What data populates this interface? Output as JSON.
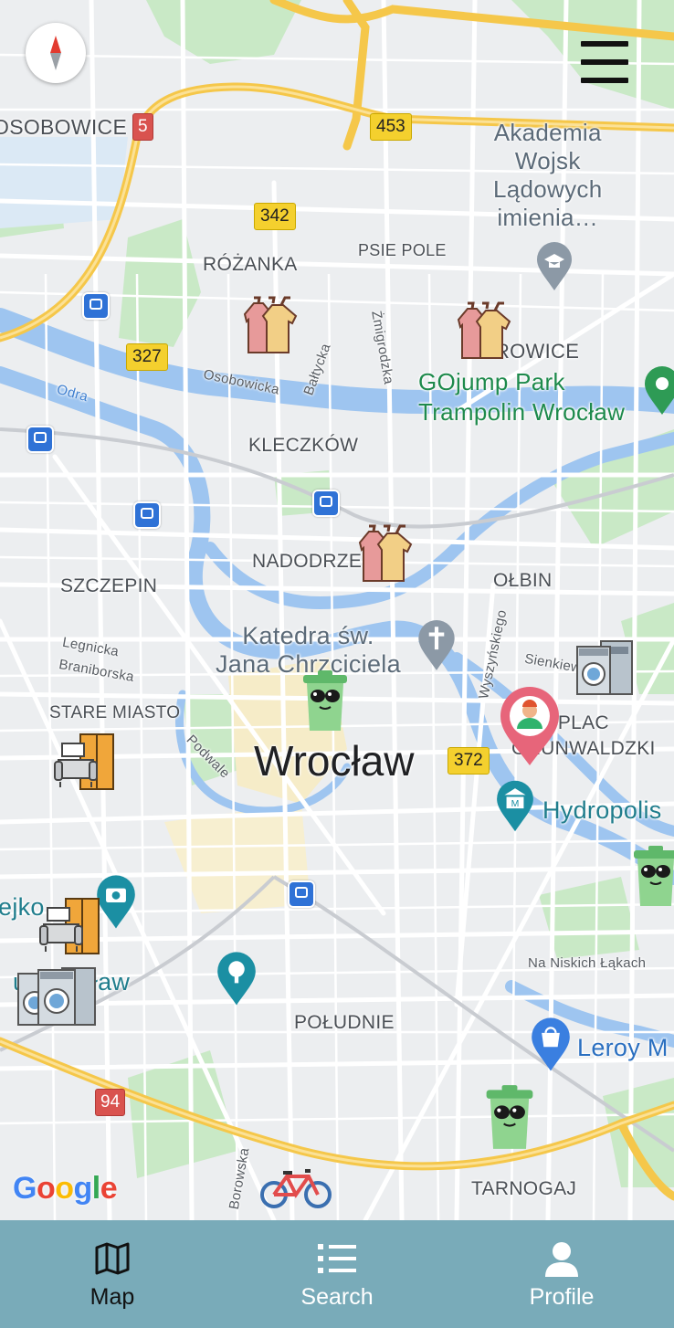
{
  "map": {
    "labels": {
      "osobowice": "OSOBOWICE",
      "rozanka": "RÓŻANKA",
      "psie_pole": "PSIE POLE",
      "akademia": "Akademia\nWojsk\nLądowych\nimienia…",
      "karlowice": "KAROWICE",
      "gojump": "GOjump Park\nTrampolin Wrocław",
      "kleczkow": "KLECZKÓW",
      "nadodrze": "NADODRZE",
      "szczepin": "SZCZEPIN",
      "olbin": "OŁBIN",
      "katedra": "Katedra św.\nJana Chrzciciela",
      "legnicka": "Legnicka",
      "braniborska": "Braniborska",
      "stare_miasto": "STARE MIASTO",
      "podwale": "Podwale",
      "city": "Wrocław",
      "plac_grunwaldzki": "PLAC\nGRUNWALDZKI",
      "sienkiewicza": "Sienkiew",
      "hydropolis": "Hydropolis",
      "ejko": "ejko",
      "u_wroclaw": "u Wrocław",
      "na_niskich_lakach": "Na Niskich Łąkach",
      "poludnie": "POŁUDNIE",
      "leroy": "Leroy M",
      "tarnogaj": "TARNOGAJ",
      "osobowicka": "Osobowicka",
      "baltycka": "Bałtycka",
      "zmigrodzka": "Żmigrodzka",
      "odra": "Odra",
      "wyszynskiego": "Wyszyńskiego",
      "borowska": "Borowska"
    },
    "shields": {
      "r5": "5",
      "r453": "453",
      "r342": "342",
      "r327": "327",
      "r372": "372",
      "r94": "94"
    },
    "attribution": "Google"
  },
  "nav": {
    "map": "Map",
    "search": "Search",
    "profile": "Profile"
  },
  "colors": {
    "nav_bg": "#79abb9",
    "water": "#9ec5f0",
    "park": "#c7e8c6",
    "highway": "#f5c74a"
  }
}
